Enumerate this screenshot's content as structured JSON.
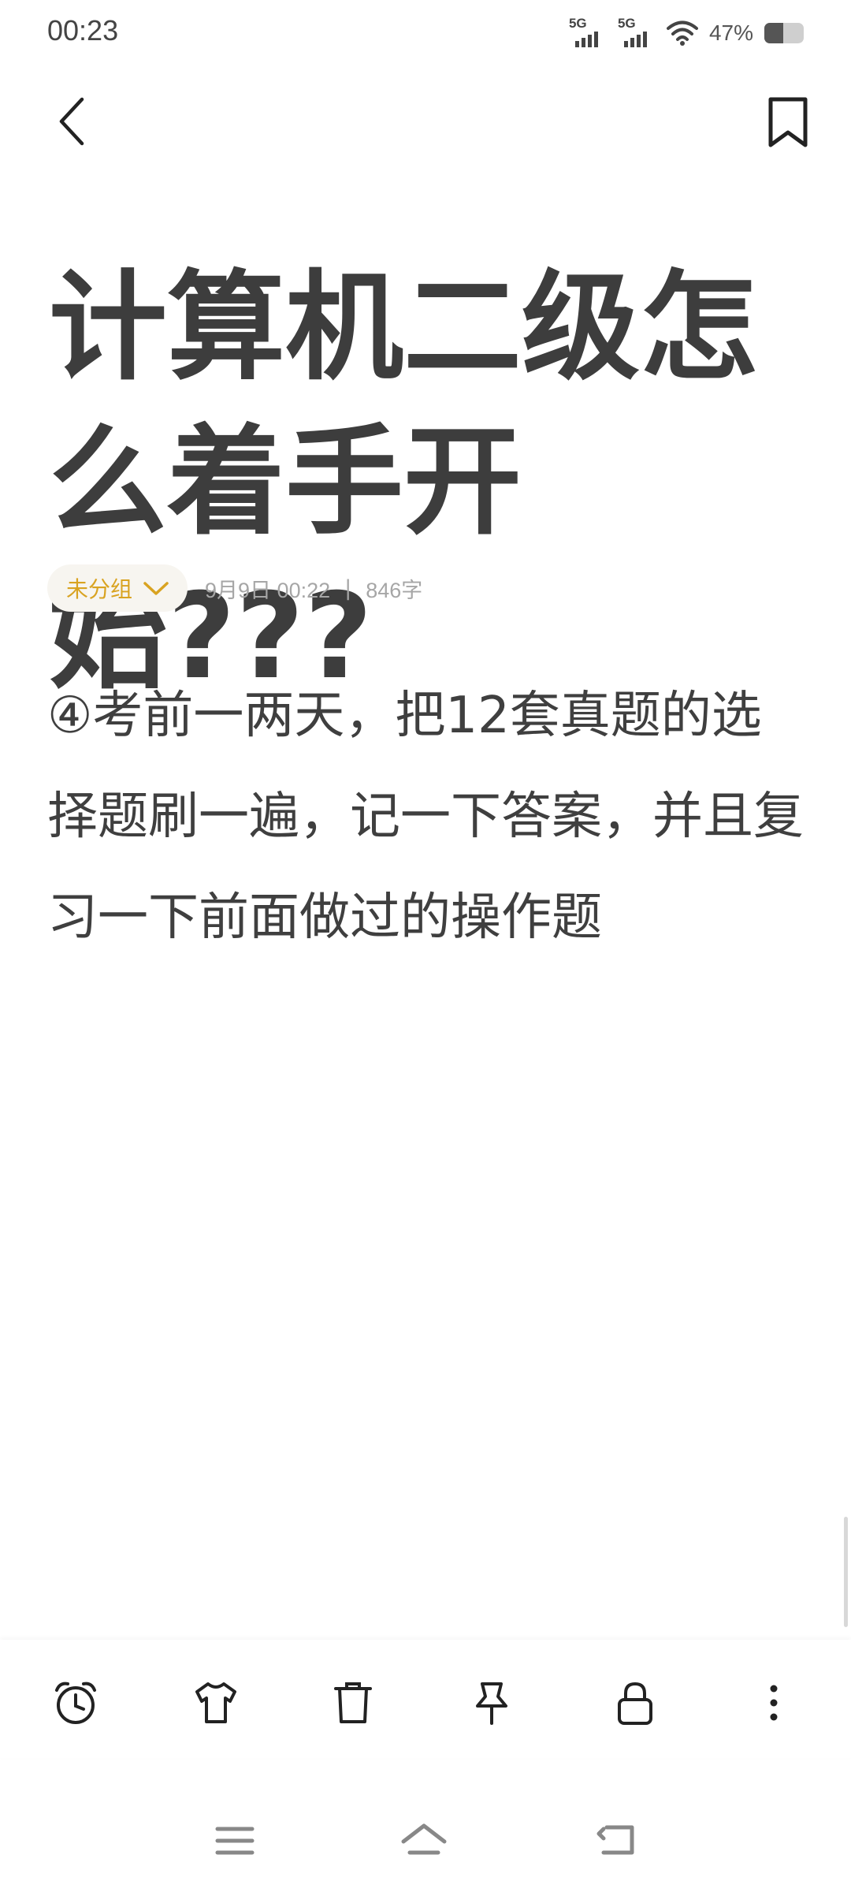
{
  "status_bar": {
    "time": "00:23",
    "signal_1_label": "5G",
    "signal_2_label": "5G",
    "battery_percent_text": "47%",
    "battery_level": 0.47
  },
  "header": {
    "back_icon": "chevron-left-icon",
    "bookmark_icon": "bookmark-icon"
  },
  "note": {
    "title": "计算机二级怎么着手开始???",
    "group_label": "未分组",
    "date": "9月9日 00:22",
    "separator": "|",
    "word_count": "846字",
    "body": "④考前一两天，把12套真题的选择题刷一遍，记一下答案，并且复习一下前面做过的操作题"
  },
  "toolbar": {
    "items": [
      "alarm-clock-icon",
      "tshirt-icon",
      "trash-icon",
      "pin-icon",
      "lock-icon",
      "more-vertical-icon"
    ]
  },
  "nav_bar": {
    "items": [
      "menu-icon",
      "home-icon",
      "back-icon"
    ]
  },
  "colors": {
    "accent": "#d9a321",
    "text": "#3f3f3f",
    "meta": "#a6a6a6"
  }
}
